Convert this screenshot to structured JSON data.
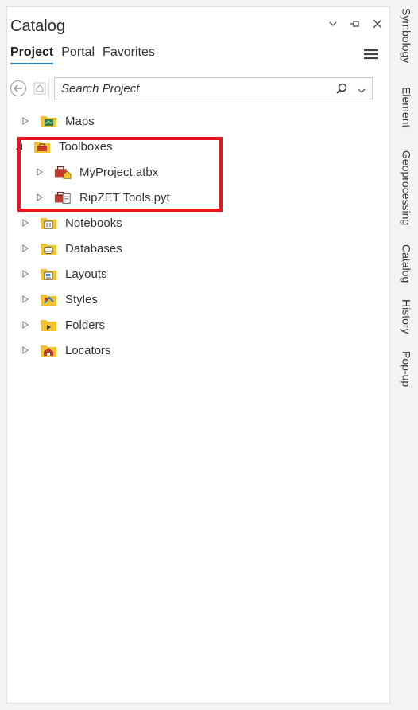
{
  "pane": {
    "title": "Catalog",
    "controls": [
      "chevron-down-icon",
      "pin-icon",
      "close-icon"
    ]
  },
  "tabs": [
    {
      "label": "Project",
      "active": true
    },
    {
      "label": "Portal",
      "active": false
    },
    {
      "label": "Favorites",
      "active": false
    }
  ],
  "search": {
    "placeholder": "Search Project",
    "value": ""
  },
  "tree": [
    {
      "label": "Maps",
      "icon": "maps-folder-icon",
      "expanded": false
    },
    {
      "label": "Toolboxes",
      "icon": "toolboxes-folder-icon",
      "expanded": true,
      "children": [
        {
          "label": "MyProject.atbx",
          "icon": "toolbox-icon"
        },
        {
          "label": "RipZET Tools.pyt",
          "icon": "python-toolbox-icon"
        }
      ]
    },
    {
      "label": "Notebooks",
      "icon": "notebooks-folder-icon",
      "expanded": false
    },
    {
      "label": "Databases",
      "icon": "databases-folder-icon",
      "expanded": false
    },
    {
      "label": "Layouts",
      "icon": "layouts-folder-icon",
      "expanded": false
    },
    {
      "label": "Styles",
      "icon": "styles-folder-icon",
      "expanded": false
    },
    {
      "label": "Folders",
      "icon": "folders-folder-icon",
      "expanded": false
    },
    {
      "label": "Locators",
      "icon": "locators-folder-icon",
      "expanded": false
    }
  ],
  "side_tabs": [
    "Symbology",
    "Element",
    "Geoprocessing",
    "Catalog",
    "History",
    "Pop-up"
  ],
  "colors": {
    "accent": "#2f7dc1",
    "folder": "#f2c230",
    "highlight": "#e8141e",
    "toolbox": "#c0392b"
  }
}
